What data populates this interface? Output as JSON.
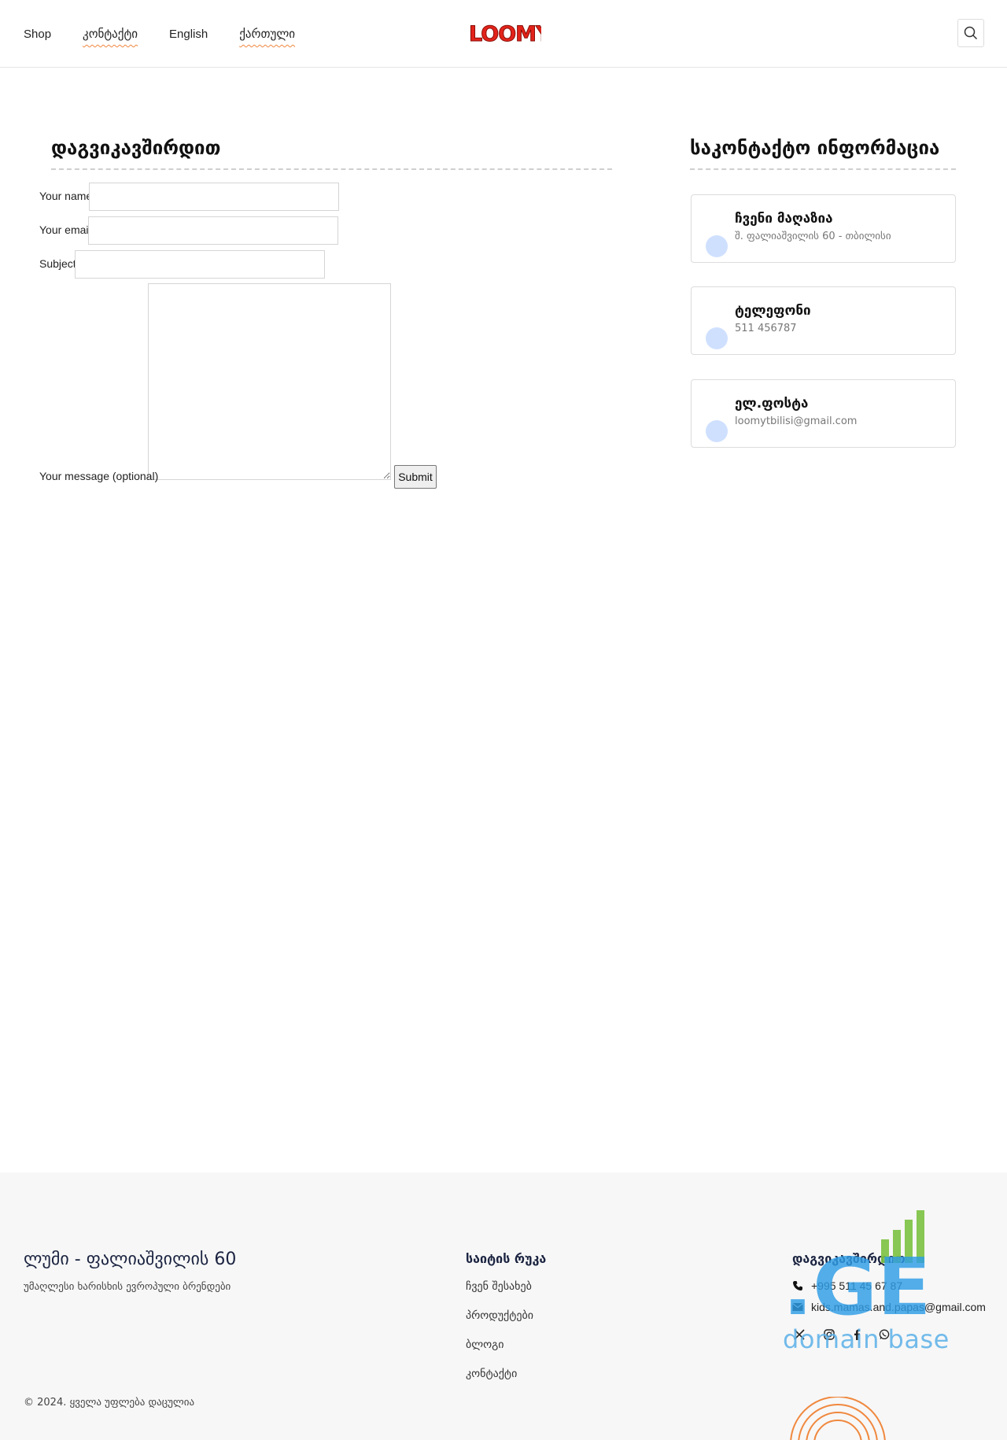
{
  "header": {
    "nav": [
      {
        "label": "Shop",
        "wavy": false
      },
      {
        "label": "კონტაქტი",
        "wavy": true
      },
      {
        "label": "English",
        "wavy": false
      },
      {
        "label": "ქართული",
        "wavy": true
      }
    ],
    "logo_text": "LOOMY"
  },
  "contact_form": {
    "title": "დაგვიკავშირდით",
    "fields": {
      "name_label": "Your name",
      "email_label": "Your email",
      "subject_label": "Subject",
      "message_label": "Your message (optional)"
    },
    "submit_label": "Submit"
  },
  "contact_info": {
    "title": "საკონტაქტო ინფორმაცია",
    "cards": [
      {
        "title": "ჩვენი მაღაზია",
        "value": "შ. ფალიაშვილის 60 - თბილისი"
      },
      {
        "title": "ტელეფონი",
        "value": "511 456787"
      },
      {
        "title": "ელ.ფოსტა",
        "value": "loomytbilisi@gmail.com"
      }
    ]
  },
  "footer": {
    "brand": "ლუმი - ფალიაშვილის 60",
    "tagline": "უმაღლესი ხარისხის ევროპული ბრენდები",
    "copyright": "© 2024. ყველა უფლება დაცულია",
    "sitemap_title": "საიტის რუკა",
    "sitemap_links": [
      "ჩვენ შესახებ",
      "პროდუქტები",
      "ბლოგი",
      "კონტაქტი"
    ],
    "contact_title": "დაგვიკავშირდით",
    "phone": "+995 511 45 67 87",
    "email": "kids.mamas.and.papas@gmail.com",
    "social": [
      "x-icon",
      "instagram-icon",
      "facebook-icon",
      "whatsapp-icon"
    ]
  },
  "watermark": {
    "mark": ".GE",
    "text": "domain base"
  },
  "colors": {
    "logo_red": "#e2231a",
    "accent_orange": "#f0883e",
    "card_dot": "#cfe0ff",
    "footer_bg": "#f7f7f7",
    "watermark_blue": "#2f9ee6",
    "watermark_green": "#7cc242"
  }
}
